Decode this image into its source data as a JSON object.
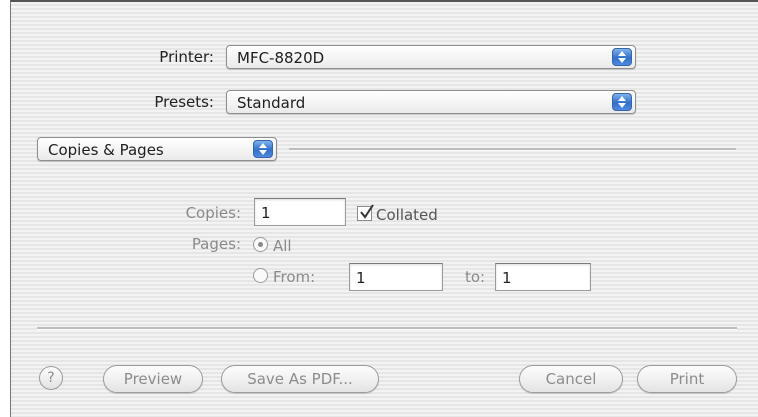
{
  "printer": {
    "label": "Printer:",
    "value": "MFC-8820D"
  },
  "presets": {
    "label": "Presets:",
    "value": "Standard"
  },
  "panel": {
    "value": "Copies & Pages"
  },
  "copies": {
    "label": "Copies:",
    "value": "1",
    "collated_label": "Collated",
    "collated_checked": true
  },
  "pages": {
    "label": "Pages:",
    "all_label": "All",
    "from_label": "From:",
    "from_value": "1",
    "to_label": "to:",
    "to_value": "1",
    "selected": "All"
  },
  "buttons": {
    "help": "?",
    "preview": "Preview",
    "save_pdf": "Save As PDF...",
    "cancel": "Cancel",
    "print": "Print"
  },
  "colors": {
    "popup_arrow": "#2f6fd0",
    "dim_text": "#8a8a8a"
  },
  "icons": {
    "popup_arrows": "up-down-arrows-icon",
    "check": "checkmark-icon",
    "help": "question-mark-icon"
  }
}
